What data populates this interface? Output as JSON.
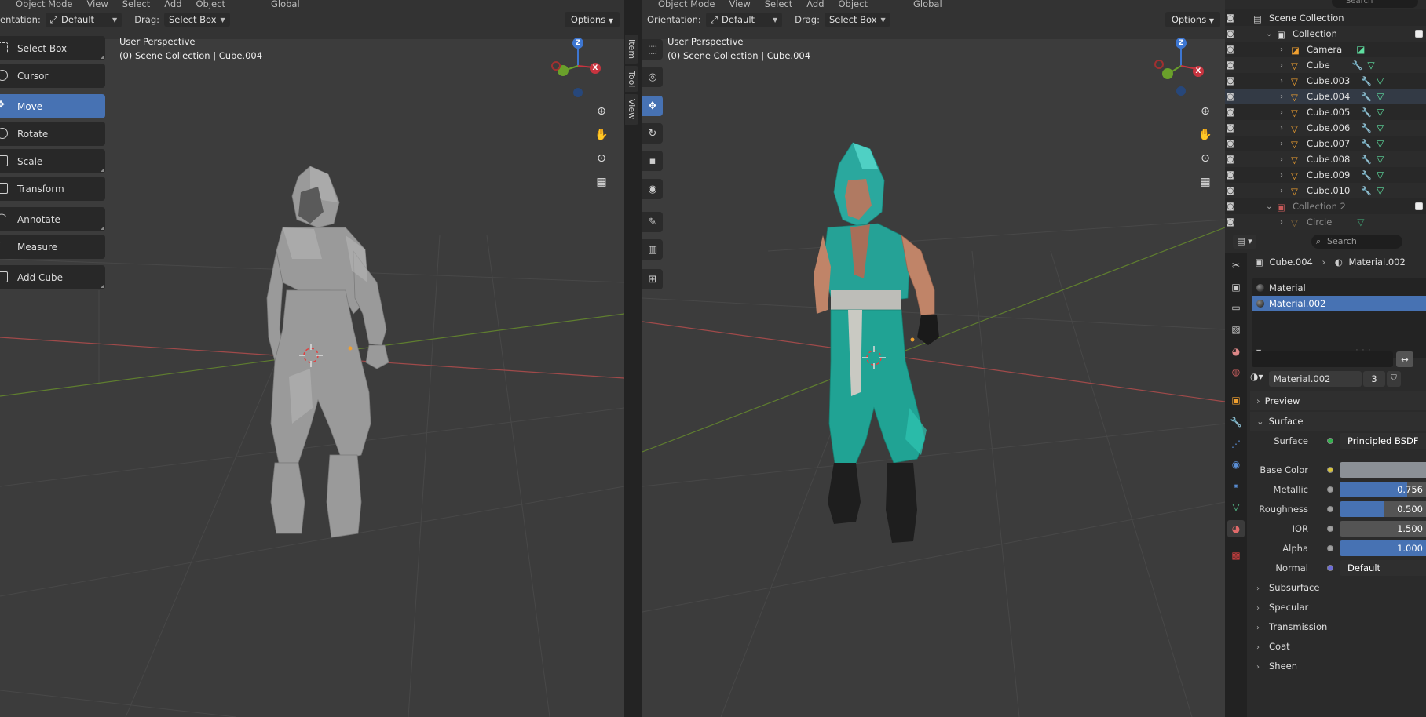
{
  "left_viewport": {
    "menu": [
      "Object Mode",
      "View",
      "Select",
      "Add",
      "Object",
      "Global"
    ],
    "orientation_label": "entation:",
    "orientation_value": "Default",
    "drag_label": "Drag:",
    "drag_value": "Select Box",
    "options_label": "Options",
    "overlay_line1": "User Perspective",
    "overlay_line2": "(0) Scene Collection | Cube.004",
    "side_tabs": [
      "Item",
      "Tool",
      "View"
    ],
    "tools": [
      {
        "label": "Select Box"
      },
      {
        "label": "Cursor"
      },
      {
        "label": "Move",
        "selected": true
      },
      {
        "label": "Rotate"
      },
      {
        "label": "Scale"
      },
      {
        "label": "Transform"
      },
      {
        "label": "Annotate"
      },
      {
        "label": "Measure"
      },
      {
        "label": "Add Cube"
      }
    ]
  },
  "right_viewport": {
    "menu": [
      "Object Mode",
      "View",
      "Select",
      "Add",
      "Object",
      "Global"
    ],
    "orientation_label": "Orientation:",
    "orientation_value": "Default",
    "drag_label": "Drag:",
    "drag_value": "Select Box",
    "options_label": "Options",
    "overlay_line1": "User Perspective",
    "overlay_line2": "(0) Scene Collection | Cube.004"
  },
  "gizmo": {
    "x": "X",
    "y": "Y",
    "z": "Z"
  },
  "outliner": {
    "search_placeholder": "Search",
    "rows": [
      {
        "label": "Scene Collection",
        "type": "scene",
        "indent": 0
      },
      {
        "label": "Collection",
        "type": "collection",
        "indent": 1,
        "expanded": true
      },
      {
        "label": "Camera",
        "type": "camera",
        "indent": 2
      },
      {
        "label": "Cube",
        "type": "mesh",
        "indent": 2
      },
      {
        "label": "Cube.003",
        "type": "mesh",
        "indent": 2
      },
      {
        "label": "Cube.004",
        "type": "mesh",
        "indent": 2,
        "active": true
      },
      {
        "label": "Cube.005",
        "type": "mesh",
        "indent": 2
      },
      {
        "label": "Cube.006",
        "type": "mesh",
        "indent": 2
      },
      {
        "label": "Cube.007",
        "type": "mesh",
        "indent": 2
      },
      {
        "label": "Cube.008",
        "type": "mesh",
        "indent": 2
      },
      {
        "label": "Cube.009",
        "type": "mesh",
        "indent": 2
      },
      {
        "label": "Cube.010",
        "type": "mesh",
        "indent": 2
      },
      {
        "label": "Collection 2",
        "type": "collection-dim",
        "indent": 1,
        "expanded": true
      },
      {
        "label": "Circle",
        "type": "mesh-dim",
        "indent": 2
      }
    ]
  },
  "properties": {
    "search_placeholder": "Search",
    "breadcrumb_object": "Cube.004",
    "breadcrumb_material": "Material.002",
    "slots": [
      "Material",
      "Material.002"
    ],
    "active_slot": 1,
    "material_name": "Material.002",
    "user_count": "3",
    "preview_label": "Preview",
    "surface_label": "Surface",
    "fields": [
      {
        "label": "Surface",
        "value": "Principled BSDF",
        "dot": "#2fb34a"
      },
      {
        "label": "Base Color",
        "value": "",
        "dot": "#d8c43a",
        "swatch": "#8b9096"
      },
      {
        "label": "Metallic",
        "value": "0.756",
        "fill": 0.756,
        "dot": "#a0a0a0"
      },
      {
        "label": "Roughness",
        "value": "0.500",
        "fill": 0.5,
        "dot": "#a0a0a0"
      },
      {
        "label": "IOR",
        "value": "1.500",
        "fill": 0,
        "dot": "#a0a0a0"
      },
      {
        "label": "Alpha",
        "value": "1.000",
        "fill": 1.0,
        "dot": "#a0a0a0"
      },
      {
        "label": "Normal",
        "value": "Default",
        "dot": "#6b6bd8"
      }
    ],
    "subpanels": [
      "Subsurface",
      "Specular",
      "Transmission",
      "Coat",
      "Sheen"
    ]
  },
  "colors": {
    "accent": "#4772b3",
    "viewport_bg": "#3c3c3c",
    "x_axis": "#c7343f",
    "y_axis": "#6aa02b",
    "z_axis": "#3d76d1"
  }
}
